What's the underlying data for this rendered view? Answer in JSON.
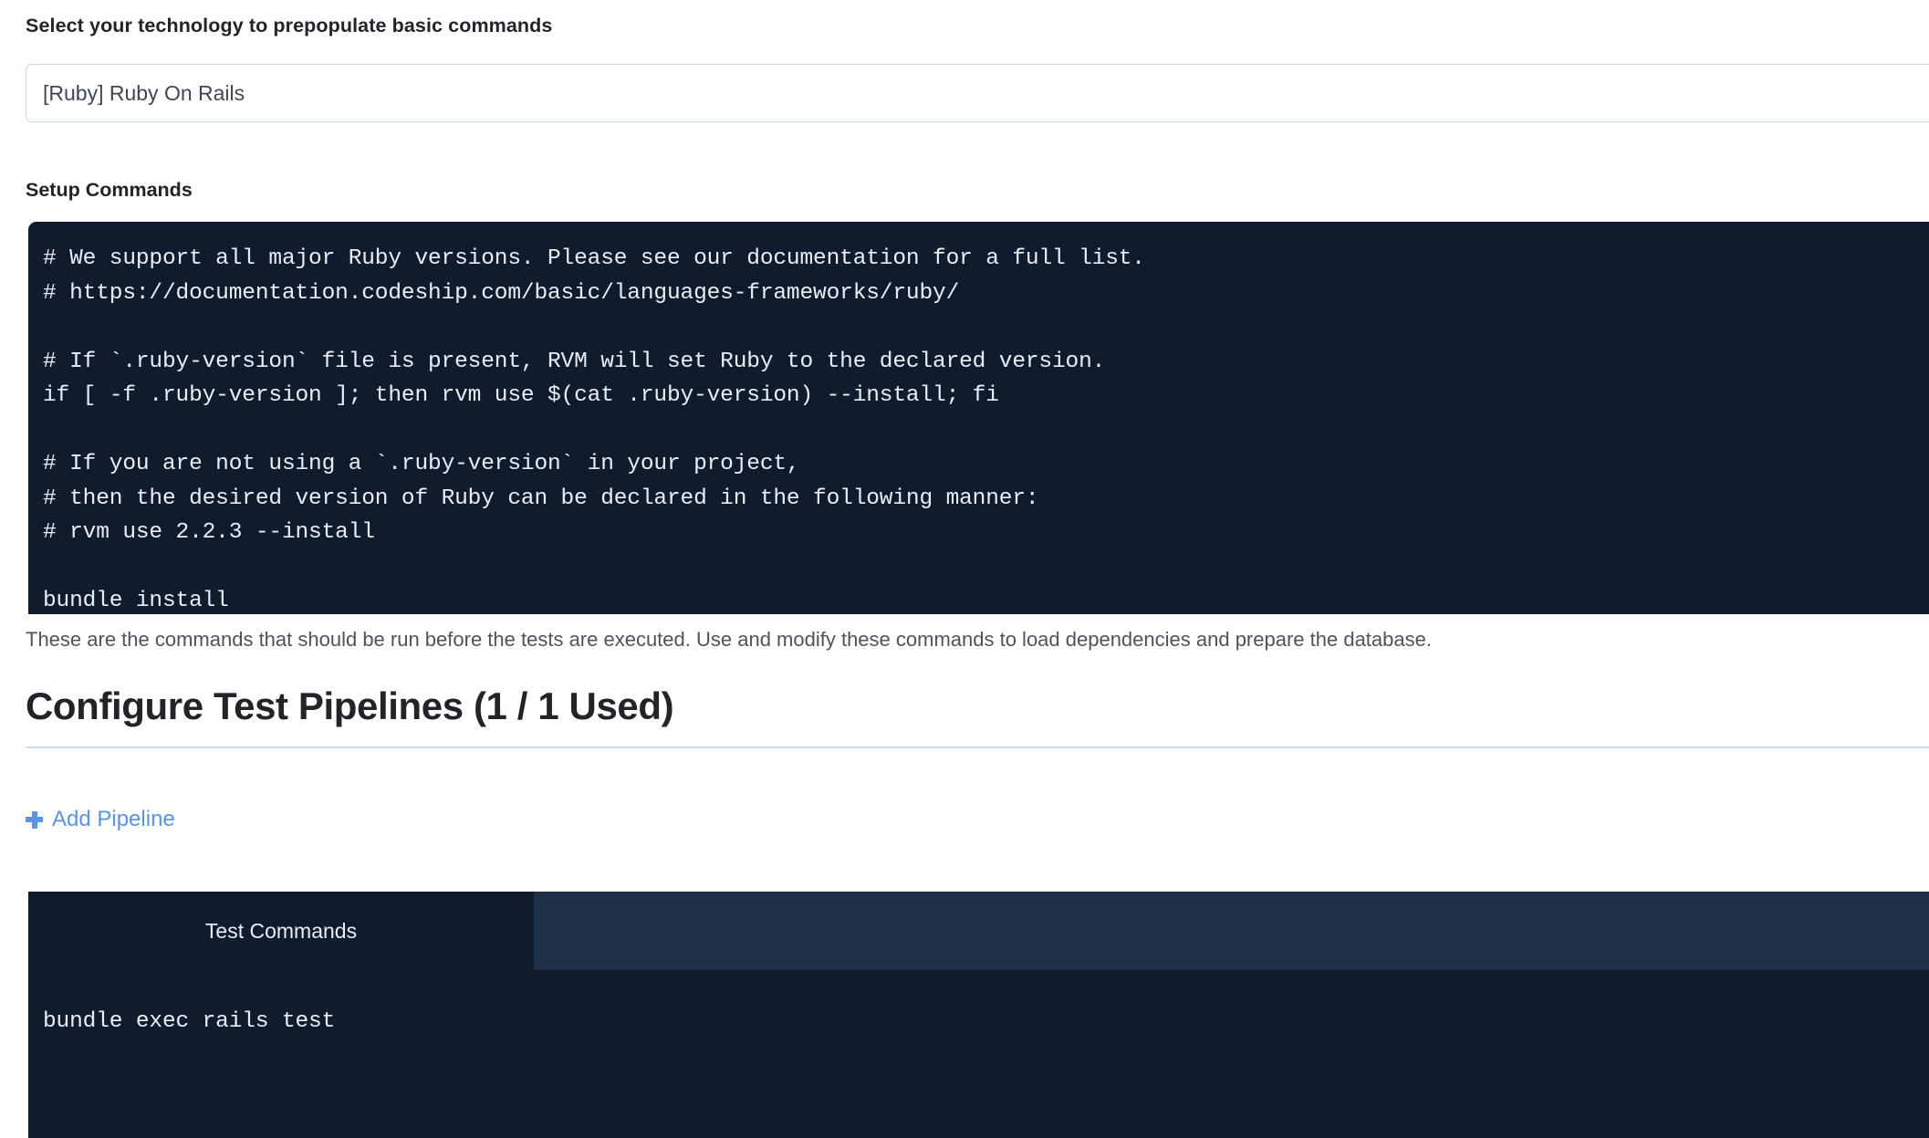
{
  "technology": {
    "label": "Select your technology to prepopulate basic commands",
    "selected_value": "[Ruby] Ruby On Rails"
  },
  "setup_commands": {
    "label": "Setup Commands",
    "code": "# We support all major Ruby versions. Please see our documentation for a full list.\n# https://documentation.codeship.com/basic/languages-frameworks/ruby/\n\n# If `.ruby-version` file is present, RVM will set Ruby to the declared version.\nif [ -f .ruby-version ]; then rvm use $(cat .ruby-version) --install; fi\n\n# If you are not using a `.ruby-version` in your project,\n# then the desired version of Ruby can be declared in the following manner:\n# rvm use 2.2.3 --install\n\nbundle install",
    "help_text": "These are the commands that should be run before the tests are executed. Use and modify these commands to load dependencies and prepare the database."
  },
  "pipelines": {
    "heading": "Configure Test Pipelines (1 / 1 Used)",
    "add_pipeline_label": "Add Pipeline",
    "add_pipeline_icon": "plus-icon",
    "tab_label": "Test Commands",
    "code": "bundle exec rails test"
  },
  "colors": {
    "code_background": "#101c2b",
    "tabbar_inactive": "#1f3148",
    "link": "#5a93e8",
    "border": "#c9d7ef",
    "divider": "#cfdcef"
  }
}
